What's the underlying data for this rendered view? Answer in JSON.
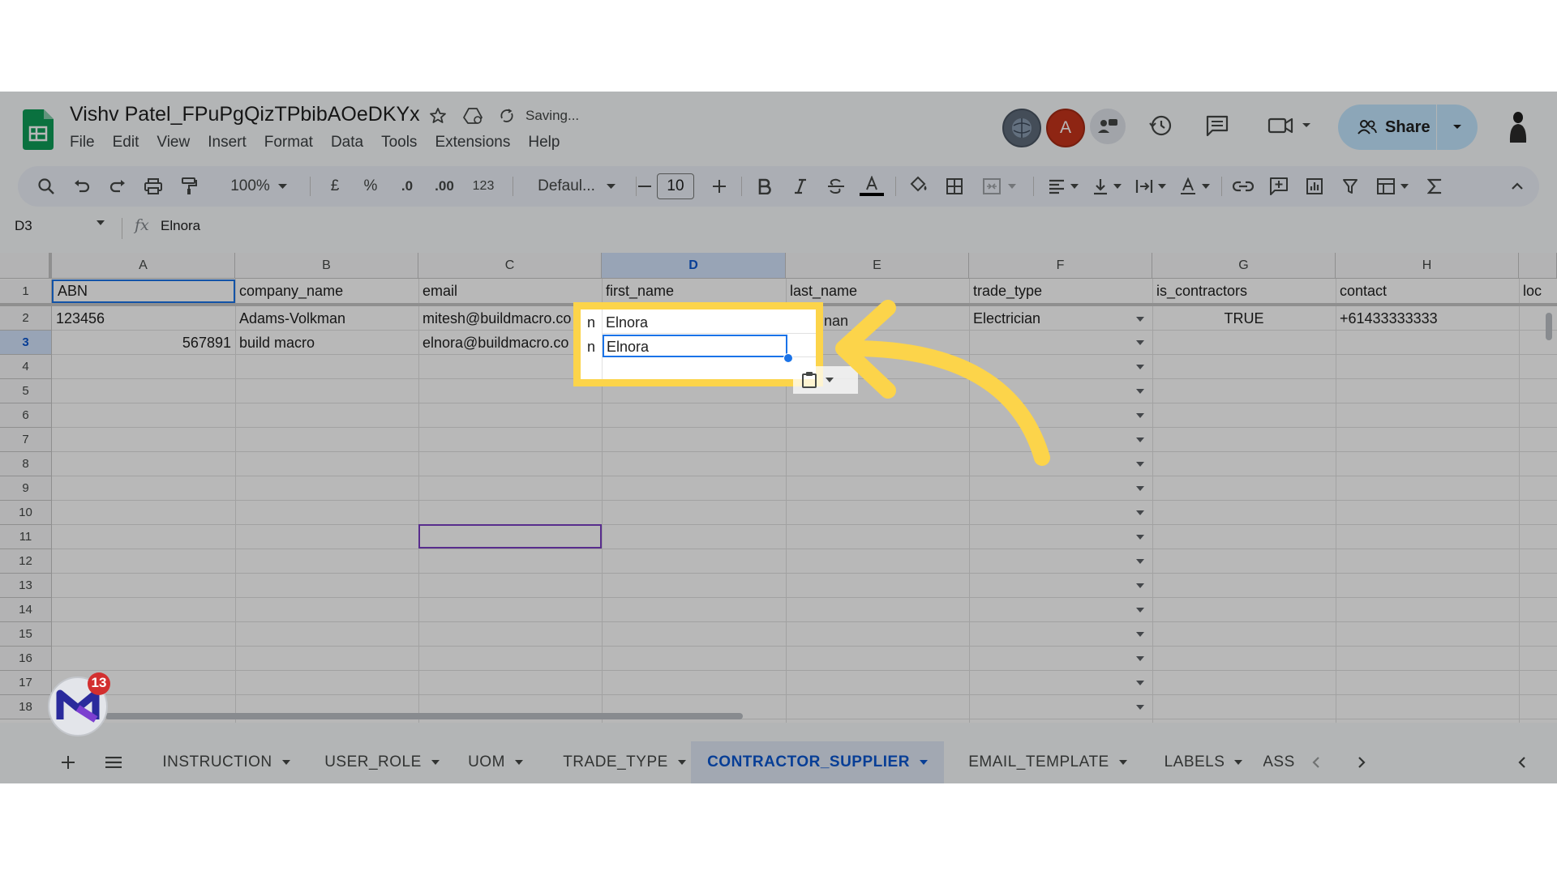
{
  "doc": {
    "title": "Vishv Patel_FPuPgQizTPbibAOeDKYx",
    "status": "Saving..."
  },
  "menu": [
    "File",
    "Edit",
    "View",
    "Insert",
    "Format",
    "Data",
    "Tools",
    "Extensions",
    "Help"
  ],
  "header": {
    "avatar_letter": "A",
    "share_label": "Share"
  },
  "toolbar": {
    "zoom": "100%",
    "currency": "£",
    "percent": "%",
    "dec_minus": ".0",
    "dec_plus": ".00",
    "number_format": "123",
    "font": "Defaul...",
    "font_size": "10"
  },
  "formula": {
    "cell_ref": "D3",
    "fx": "fx",
    "value": "Elnora"
  },
  "columns": [
    {
      "letter": "A",
      "header": "ABN"
    },
    {
      "letter": "B",
      "header": "company_name"
    },
    {
      "letter": "C",
      "header": "email"
    },
    {
      "letter": "D",
      "header": "first_name"
    },
    {
      "letter": "E",
      "header": "last_name"
    },
    {
      "letter": "F",
      "header": "trade_type"
    },
    {
      "letter": "G",
      "header": "is_contractors"
    },
    {
      "letter": "H",
      "header": "contact"
    },
    {
      "letter": "",
      "header": "loc"
    }
  ],
  "rows": [
    {
      "abn": "123456",
      "company": "Adams-Volkman",
      "email": "mitesh@buildmacro.co",
      "email_tail": "n",
      "first": "Elnora",
      "last_start": "True",
      "last_end": "nan",
      "trade": "Electrician",
      "is_contractor": "TRUE",
      "contact": "+61433333333"
    },
    {
      "abn": "567891",
      "company": "build macro",
      "email": "elnora@buildmacro.co",
      "email_tail": "n",
      "first": "Elnora",
      "last_start": "",
      "last_end": "",
      "trade": "",
      "is_contractor": "",
      "contact": ""
    }
  ],
  "row_numbers": [
    "1",
    "2",
    "3",
    "4",
    "5",
    "6",
    "7",
    "8",
    "9",
    "10",
    "11",
    "12",
    "13",
    "14",
    "15",
    "16",
    "17",
    "18"
  ],
  "sheets": [
    "INSTRUCTION",
    "USER_ROLE",
    "UOM",
    "TRADE_TYPE",
    "CONTRACTOR_SUPPLIER",
    "EMAIL_TEMPLATE",
    "LABELS",
    "ASS"
  ],
  "active_sheet": "CONTRACTOR_SUPPLIER",
  "badge_count": "13",
  "colors": {
    "highlight": "#fcd44a",
    "sheets_green": "#0f9d58",
    "selection_blue": "#1a73e8",
    "share_bg": "#c2e7ff"
  }
}
